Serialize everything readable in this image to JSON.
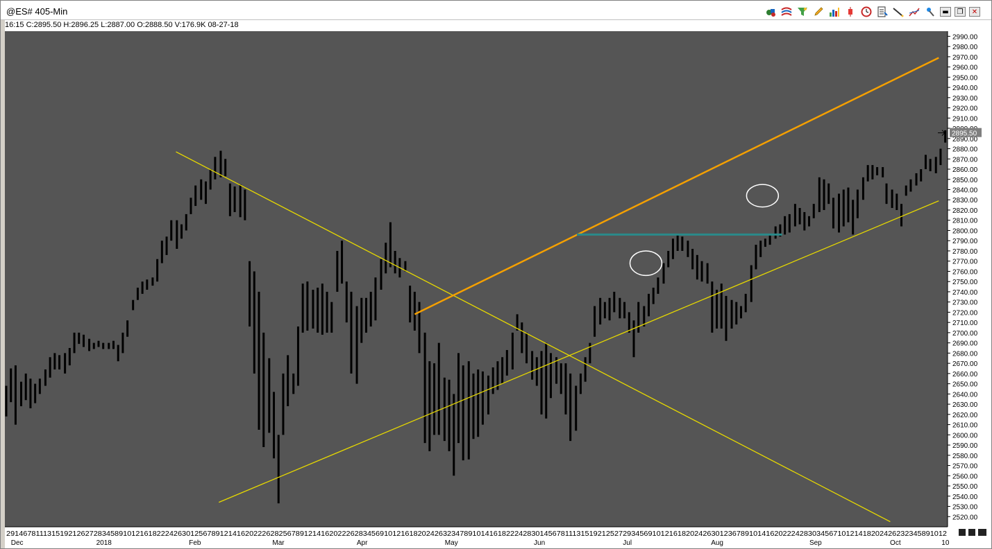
{
  "window": {
    "title": "@ES# 405-Min",
    "quote_line": "16:15  C:2895.50  H:2896.25  L:2887.00  O:2888.50  V:176.9K  08-27-18"
  },
  "toolbar": {
    "icons": [
      "shapes-icon",
      "waves-icon",
      "funnel-icon",
      "pencil-icon",
      "bar-chart-icon",
      "candlestick-icon",
      "clock-icon",
      "list-icon",
      "draw-line-icon",
      "trend-icon",
      "pin-icon"
    ],
    "min_label": "▬",
    "restore_label": "❐",
    "close_label": "✕"
  },
  "colors": {
    "chart_bg": "#555555",
    "bars": "#000000",
    "resistance_line": "#f5a000",
    "trend_lines": "#e6d800",
    "horizontal_level": "#2a8a8a",
    "ellipse": "#ffffff",
    "axis_bg": "#ffffff"
  },
  "chart_data": {
    "type": "ohlc",
    "title": "@ES# 405-Min",
    "ylim": [
      2510,
      2995
    ],
    "y_ticks": [
      2520,
      2530,
      2540,
      2550,
      2560,
      2570,
      2580,
      2590,
      2600,
      2610,
      2620,
      2630,
      2640,
      2650,
      2660,
      2670,
      2680,
      2690,
      2700,
      2710,
      2720,
      2730,
      2740,
      2750,
      2760,
      2770,
      2780,
      2790,
      2800,
      2810,
      2820,
      2830,
      2840,
      2850,
      2860,
      2870,
      2880,
      2890,
      2900,
      2910,
      2920,
      2930,
      2940,
      2950,
      2960,
      2970,
      2980,
      2990
    ],
    "last_price": "2895.50",
    "x_day_labels": "29146781113151921262728345891012161822242630125678912141620222628256789121416202226283456910121618202426323478910141618222428301456781113151921252729345691012161820242630123678910141620222428303456710121418202426232345891012",
    "x_month_labels": [
      {
        "label": "Dec",
        "pos": 0.005
      },
      {
        "label": "2018",
        "pos": 0.096
      },
      {
        "label": "Feb",
        "pos": 0.195
      },
      {
        "label": "Mar",
        "pos": 0.284
      },
      {
        "label": "Apr",
        "pos": 0.374
      },
      {
        "label": "May",
        "pos": 0.468
      },
      {
        "label": "Jun",
        "pos": 0.563
      },
      {
        "label": "Jul",
        "pos": 0.658
      },
      {
        "label": "Aug",
        "pos": 0.752
      },
      {
        "label": "Sep",
        "pos": 0.857
      },
      {
        "label": "Oct",
        "pos": 0.943
      },
      {
        "label": "10",
        "pos": 0.998
      }
    ],
    "bars": [
      {
        "x": 0.0,
        "h": 2648,
        "l": 2618
      },
      {
        "x": 0.005,
        "h": 2665,
        "l": 2632
      },
      {
        "x": 0.01,
        "h": 2668,
        "l": 2610
      },
      {
        "x": 0.016,
        "h": 2652,
        "l": 2628
      },
      {
        "x": 0.021,
        "h": 2660,
        "l": 2634
      },
      {
        "x": 0.026,
        "h": 2655,
        "l": 2626
      },
      {
        "x": 0.031,
        "h": 2650,
        "l": 2631
      },
      {
        "x": 0.036,
        "h": 2655,
        "l": 2640
      },
      {
        "x": 0.042,
        "h": 2664,
        "l": 2648
      },
      {
        "x": 0.047,
        "h": 2676,
        "l": 2656
      },
      {
        "x": 0.052,
        "h": 2680,
        "l": 2664
      },
      {
        "x": 0.057,
        "h": 2678,
        "l": 2664
      },
      {
        "x": 0.063,
        "h": 2680,
        "l": 2660
      },
      {
        "x": 0.068,
        "h": 2685,
        "l": 2668
      },
      {
        "x": 0.073,
        "h": 2700,
        "l": 2680
      },
      {
        "x": 0.078,
        "h": 2700,
        "l": 2689
      },
      {
        "x": 0.083,
        "h": 2698,
        "l": 2686
      },
      {
        "x": 0.089,
        "h": 2694,
        "l": 2682
      },
      {
        "x": 0.094,
        "h": 2690,
        "l": 2684
      },
      {
        "x": 0.099,
        "h": 2692,
        "l": 2686
      },
      {
        "x": 0.104,
        "h": 2690,
        "l": 2684
      },
      {
        "x": 0.11,
        "h": 2690,
        "l": 2684
      },
      {
        "x": 0.115,
        "h": 2692,
        "l": 2684
      },
      {
        "x": 0.12,
        "h": 2688,
        "l": 2672
      },
      {
        "x": 0.125,
        "h": 2700,
        "l": 2680
      },
      {
        "x": 0.13,
        "h": 2712,
        "l": 2696
      },
      {
        "x": 0.136,
        "h": 2732,
        "l": 2722
      },
      {
        "x": 0.141,
        "h": 2744,
        "l": 2732
      },
      {
        "x": 0.146,
        "h": 2750,
        "l": 2738
      },
      {
        "x": 0.151,
        "h": 2752,
        "l": 2742
      },
      {
        "x": 0.157,
        "h": 2754,
        "l": 2746
      },
      {
        "x": 0.162,
        "h": 2772,
        "l": 2750
      },
      {
        "x": 0.167,
        "h": 2790,
        "l": 2768
      },
      {
        "x": 0.172,
        "h": 2794,
        "l": 2776
      },
      {
        "x": 0.177,
        "h": 2810,
        "l": 2790
      },
      {
        "x": 0.183,
        "h": 2810,
        "l": 2782
      },
      {
        "x": 0.188,
        "h": 2806,
        "l": 2792
      },
      {
        "x": 0.193,
        "h": 2816,
        "l": 2800
      },
      {
        "x": 0.198,
        "h": 2832,
        "l": 2816
      },
      {
        "x": 0.203,
        "h": 2844,
        "l": 2824
      },
      {
        "x": 0.209,
        "h": 2850,
        "l": 2830
      },
      {
        "x": 0.214,
        "h": 2848,
        "l": 2826
      },
      {
        "x": 0.219,
        "h": 2860,
        "l": 2840
      },
      {
        "x": 0.224,
        "h": 2872,
        "l": 2850
      },
      {
        "x": 0.23,
        "h": 2878,
        "l": 2852
      },
      {
        "x": 0.235,
        "h": 2870,
        "l": 2853
      },
      {
        "x": 0.24,
        "h": 2846,
        "l": 2814
      },
      {
        "x": 0.245,
        "h": 2843,
        "l": 2818
      },
      {
        "x": 0.251,
        "h": 2845,
        "l": 2813
      },
      {
        "x": 0.256,
        "h": 2840,
        "l": 2810
      },
      {
        "x": 0.261,
        "h": 2770,
        "l": 2706
      },
      {
        "x": 0.266,
        "h": 2760,
        "l": 2660
      },
      {
        "x": 0.271,
        "h": 2740,
        "l": 2605
      },
      {
        "x": 0.276,
        "h": 2700,
        "l": 2588
      },
      {
        "x": 0.282,
        "h": 2675,
        "l": 2602
      },
      {
        "x": 0.287,
        "h": 2642,
        "l": 2577
      },
      {
        "x": 0.292,
        "h": 2600,
        "l": 2533
      },
      {
        "x": 0.297,
        "h": 2660,
        "l": 2600
      },
      {
        "x": 0.302,
        "h": 2678,
        "l": 2628
      },
      {
        "x": 0.308,
        "h": 2660,
        "l": 2640
      },
      {
        "x": 0.313,
        "h": 2706,
        "l": 2648
      },
      {
        "x": 0.318,
        "h": 2748,
        "l": 2700
      },
      {
        "x": 0.323,
        "h": 2750,
        "l": 2702
      },
      {
        "x": 0.329,
        "h": 2742,
        "l": 2704
      },
      {
        "x": 0.334,
        "h": 2744,
        "l": 2700
      },
      {
        "x": 0.339,
        "h": 2748,
        "l": 2698
      },
      {
        "x": 0.344,
        "h": 2740,
        "l": 2700
      },
      {
        "x": 0.349,
        "h": 2730,
        "l": 2700
      },
      {
        "x": 0.355,
        "h": 2780,
        "l": 2740
      },
      {
        "x": 0.36,
        "h": 2790,
        "l": 2748
      },
      {
        "x": 0.365,
        "h": 2750,
        "l": 2710
      },
      {
        "x": 0.37,
        "h": 2740,
        "l": 2660
      },
      {
        "x": 0.376,
        "h": 2726,
        "l": 2650
      },
      {
        "x": 0.381,
        "h": 2734,
        "l": 2690
      },
      {
        "x": 0.386,
        "h": 2734,
        "l": 2700
      },
      {
        "x": 0.391,
        "h": 2740,
        "l": 2706
      },
      {
        "x": 0.396,
        "h": 2754,
        "l": 2712
      },
      {
        "x": 0.402,
        "h": 2772,
        "l": 2742
      },
      {
        "x": 0.407,
        "h": 2788,
        "l": 2758
      },
      {
        "x": 0.412,
        "h": 2808,
        "l": 2764
      },
      {
        "x": 0.417,
        "h": 2780,
        "l": 2758
      },
      {
        "x": 0.422,
        "h": 2773,
        "l": 2754
      },
      {
        "x": 0.428,
        "h": 2770,
        "l": 2760
      },
      {
        "x": 0.433,
        "h": 2746,
        "l": 2710
      },
      {
        "x": 0.438,
        "h": 2740,
        "l": 2702
      },
      {
        "x": 0.443,
        "h": 2730,
        "l": 2680
      },
      {
        "x": 0.449,
        "h": 2700,
        "l": 2592
      },
      {
        "x": 0.454,
        "h": 2672,
        "l": 2584
      },
      {
        "x": 0.459,
        "h": 2670,
        "l": 2600
      },
      {
        "x": 0.464,
        "h": 2690,
        "l": 2600
      },
      {
        "x": 0.47,
        "h": 2656,
        "l": 2594
      },
      {
        "x": 0.475,
        "h": 2654,
        "l": 2584
      },
      {
        "x": 0.48,
        "h": 2640,
        "l": 2560
      },
      {
        "x": 0.485,
        "h": 2680,
        "l": 2592
      },
      {
        "x": 0.49,
        "h": 2668,
        "l": 2575
      },
      {
        "x": 0.496,
        "h": 2672,
        "l": 2576
      },
      {
        "x": 0.501,
        "h": 2660,
        "l": 2596
      },
      {
        "x": 0.506,
        "h": 2664,
        "l": 2598
      },
      {
        "x": 0.511,
        "h": 2662,
        "l": 2610
      },
      {
        "x": 0.517,
        "h": 2658,
        "l": 2620
      },
      {
        "x": 0.522,
        "h": 2666,
        "l": 2640
      },
      {
        "x": 0.527,
        "h": 2672,
        "l": 2644
      },
      {
        "x": 0.532,
        "h": 2676,
        "l": 2650
      },
      {
        "x": 0.537,
        "h": 2683,
        "l": 2658
      },
      {
        "x": 0.543,
        "h": 2700,
        "l": 2664
      },
      {
        "x": 0.548,
        "h": 2718,
        "l": 2702
      },
      {
        "x": 0.553,
        "h": 2710,
        "l": 2680
      },
      {
        "x": 0.558,
        "h": 2700,
        "l": 2670
      },
      {
        "x": 0.564,
        "h": 2682,
        "l": 2654
      },
      {
        "x": 0.569,
        "h": 2676,
        "l": 2648
      },
      {
        "x": 0.574,
        "h": 2682,
        "l": 2620
      },
      {
        "x": 0.579,
        "h": 2690,
        "l": 2616
      },
      {
        "x": 0.584,
        "h": 2680,
        "l": 2636
      },
      {
        "x": 0.59,
        "h": 2676,
        "l": 2650
      },
      {
        "x": 0.595,
        "h": 2670,
        "l": 2640
      },
      {
        "x": 0.6,
        "h": 2670,
        "l": 2620
      },
      {
        "x": 0.605,
        "h": 2660,
        "l": 2594
      },
      {
        "x": 0.611,
        "h": 2648,
        "l": 2604
      },
      {
        "x": 0.616,
        "h": 2660,
        "l": 2640
      },
      {
        "x": 0.621,
        "h": 2676,
        "l": 2652
      },
      {
        "x": 0.626,
        "h": 2690,
        "l": 2670
      },
      {
        "x": 0.631,
        "h": 2726,
        "l": 2696
      },
      {
        "x": 0.637,
        "h": 2734,
        "l": 2708
      },
      {
        "x": 0.642,
        "h": 2730,
        "l": 2714
      },
      {
        "x": 0.647,
        "h": 2734,
        "l": 2712
      },
      {
        "x": 0.652,
        "h": 2740,
        "l": 2720
      },
      {
        "x": 0.658,
        "h": 2734,
        "l": 2714
      },
      {
        "x": 0.663,
        "h": 2730,
        "l": 2714
      },
      {
        "x": 0.668,
        "h": 2720,
        "l": 2700
      },
      {
        "x": 0.673,
        "h": 2712,
        "l": 2676
      },
      {
        "x": 0.678,
        "h": 2730,
        "l": 2700
      },
      {
        "x": 0.684,
        "h": 2726,
        "l": 2706
      },
      {
        "x": 0.689,
        "h": 2738,
        "l": 2716
      },
      {
        "x": 0.694,
        "h": 2744,
        "l": 2728
      },
      {
        "x": 0.699,
        "h": 2754,
        "l": 2738
      },
      {
        "x": 0.705,
        "h": 2768,
        "l": 2748
      },
      {
        "x": 0.71,
        "h": 2780,
        "l": 2764
      },
      {
        "x": 0.715,
        "h": 2792,
        "l": 2772
      },
      {
        "x": 0.72,
        "h": 2796,
        "l": 2780
      },
      {
        "x": 0.725,
        "h": 2794,
        "l": 2780
      },
      {
        "x": 0.731,
        "h": 2790,
        "l": 2774
      },
      {
        "x": 0.736,
        "h": 2782,
        "l": 2762
      },
      {
        "x": 0.741,
        "h": 2776,
        "l": 2752
      },
      {
        "x": 0.746,
        "h": 2770,
        "l": 2750
      },
      {
        "x": 0.752,
        "h": 2768,
        "l": 2748
      },
      {
        "x": 0.757,
        "h": 2750,
        "l": 2700
      },
      {
        "x": 0.762,
        "h": 2742,
        "l": 2704
      },
      {
        "x": 0.767,
        "h": 2748,
        "l": 2704
      },
      {
        "x": 0.772,
        "h": 2736,
        "l": 2692
      },
      {
        "x": 0.778,
        "h": 2732,
        "l": 2704
      },
      {
        "x": 0.783,
        "h": 2730,
        "l": 2708
      },
      {
        "x": 0.788,
        "h": 2726,
        "l": 2714
      },
      {
        "x": 0.793,
        "h": 2738,
        "l": 2720
      },
      {
        "x": 0.799,
        "h": 2766,
        "l": 2730
      },
      {
        "x": 0.804,
        "h": 2786,
        "l": 2762
      },
      {
        "x": 0.809,
        "h": 2790,
        "l": 2774
      },
      {
        "x": 0.814,
        "h": 2792,
        "l": 2784
      },
      {
        "x": 0.819,
        "h": 2796,
        "l": 2786
      },
      {
        "x": 0.825,
        "h": 2804,
        "l": 2792
      },
      {
        "x": 0.83,
        "h": 2806,
        "l": 2794
      },
      {
        "x": 0.835,
        "h": 2814,
        "l": 2796
      },
      {
        "x": 0.84,
        "h": 2816,
        "l": 2798
      },
      {
        "x": 0.846,
        "h": 2826,
        "l": 2804
      },
      {
        "x": 0.851,
        "h": 2822,
        "l": 2806
      },
      {
        "x": 0.856,
        "h": 2818,
        "l": 2800
      },
      {
        "x": 0.861,
        "h": 2814,
        "l": 2804
      },
      {
        "x": 0.866,
        "h": 2826,
        "l": 2812
      },
      {
        "x": 0.872,
        "h": 2852,
        "l": 2818
      },
      {
        "x": 0.877,
        "h": 2850,
        "l": 2820
      },
      {
        "x": 0.882,
        "h": 2846,
        "l": 2826
      },
      {
        "x": 0.887,
        "h": 2832,
        "l": 2802
      },
      {
        "x": 0.893,
        "h": 2836,
        "l": 2798
      },
      {
        "x": 0.898,
        "h": 2840,
        "l": 2804
      },
      {
        "x": 0.903,
        "h": 2842,
        "l": 2808
      },
      {
        "x": 0.908,
        "h": 2830,
        "l": 2796
      },
      {
        "x": 0.913,
        "h": 2840,
        "l": 2812
      },
      {
        "x": 0.919,
        "h": 2852,
        "l": 2830
      },
      {
        "x": 0.924,
        "h": 2864,
        "l": 2848
      },
      {
        "x": 0.929,
        "h": 2864,
        "l": 2850
      },
      {
        "x": 0.934,
        "h": 2862,
        "l": 2854
      },
      {
        "x": 0.94,
        "h": 2862,
        "l": 2852
      }
    ],
    "bars_aug": [
      {
        "x": 0.944,
        "h": 2846,
        "l": 2826
      },
      {
        "x": 0.95,
        "h": 2840,
        "l": 2822
      },
      {
        "x": 0.955,
        "h": 2836,
        "l": 2820
      },
      {
        "x": 0.96,
        "h": 2826,
        "l": 2804
      },
      {
        "x": 0.965,
        "h": 2844,
        "l": 2834
      },
      {
        "x": 0.97,
        "h": 2850,
        "l": 2838
      },
      {
        "x": 0.976,
        "h": 2856,
        "l": 2844
      },
      {
        "x": 0.981,
        "h": 2860,
        "l": 2848
      },
      {
        "x": 0.986,
        "h": 2874,
        "l": 2860
      },
      {
        "x": 0.991,
        "h": 2870,
        "l": 2858
      },
      {
        "x": 0.997,
        "h": 2872,
        "l": 2856
      },
      {
        "x": 1.002,
        "h": 2880,
        "l": 2864
      },
      {
        "x": 1.007,
        "h": 2898,
        "l": 2886
      }
    ],
    "resistance_line": {
      "from": {
        "x": 0.438,
        "y": 2718
      },
      "to": {
        "x": 1.0,
        "y": 2969
      }
    },
    "support_line": {
      "from": {
        "x": 0.228,
        "y": 2534
      },
      "to": {
        "x": 1.0,
        "y": 2829
      }
    },
    "downtrend_line": {
      "from": {
        "x": 0.182,
        "y": 2877
      },
      "to": {
        "x": 0.948,
        "y": 2515
      }
    },
    "horizontal_level": {
      "from_x": 0.612,
      "to_x": 0.832,
      "y": 2796
    },
    "ellipses": [
      {
        "cx": 0.686,
        "cy": 2768,
        "rx": 0.017,
        "ry": 12
      },
      {
        "cx": 0.811,
        "cy": 2834,
        "rx": 0.017,
        "ry": 11
      }
    ]
  }
}
